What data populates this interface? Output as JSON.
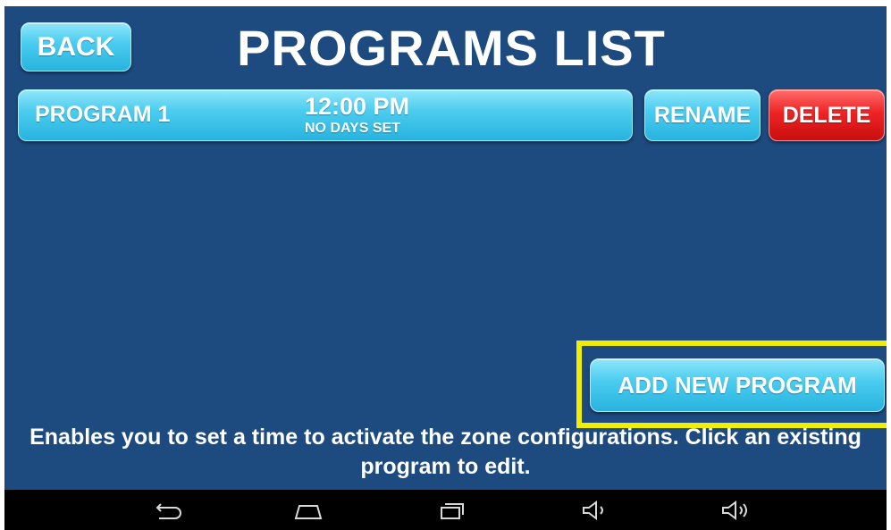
{
  "header": {
    "back_label": "BACK",
    "title": "PROGRAMS LIST"
  },
  "programs": [
    {
      "name": "PROGRAM 1",
      "time": "12:00 PM",
      "days": "NO DAYS SET",
      "rename_label": "RENAME",
      "delete_label": "DELETE"
    }
  ],
  "actions": {
    "add_new_label": "ADD NEW PROGRAM"
  },
  "help": {
    "text": "Enables you to set a time to activate the zone configurations. Click an existing program to edit."
  },
  "colors": {
    "background": "#1d4a7f",
    "button_cyan": "#3fc4ec",
    "button_red": "#e41d1d",
    "highlight": "#f2ee00"
  },
  "navbar": {
    "icons": [
      "back-icon",
      "home-icon",
      "recent-apps-icon",
      "volume-down-icon",
      "volume-up-icon"
    ]
  }
}
